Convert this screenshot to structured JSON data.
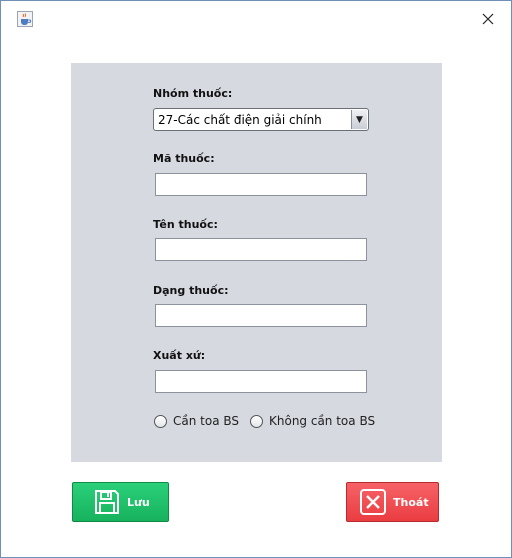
{
  "window": {
    "app_icon": "java-cup-icon",
    "close_icon": "close-icon"
  },
  "form": {
    "group_label": "Nhóm thuốc:",
    "group_selected": "27-Các chất điện giải chính",
    "code_label": "Mã thuốc:",
    "code_value": "",
    "name_label": "Tên thuốc:",
    "name_value": "",
    "form_label": "Dạng thuốc:",
    "form_value": "",
    "origin_label": "Xuất xứ:",
    "origin_value": "",
    "radio_prescription": "Cần toa BS",
    "radio_no_prescription": "Không cần toa BS"
  },
  "buttons": {
    "save_label": "Lưu",
    "save_icon": "floppy-disk-icon",
    "exit_label": "Thoát",
    "exit_icon": "x-box-icon"
  },
  "colors": {
    "panel_bg": "#d6d9e0",
    "save_green": "#1cbf68",
    "exit_red": "#f04a4f"
  }
}
